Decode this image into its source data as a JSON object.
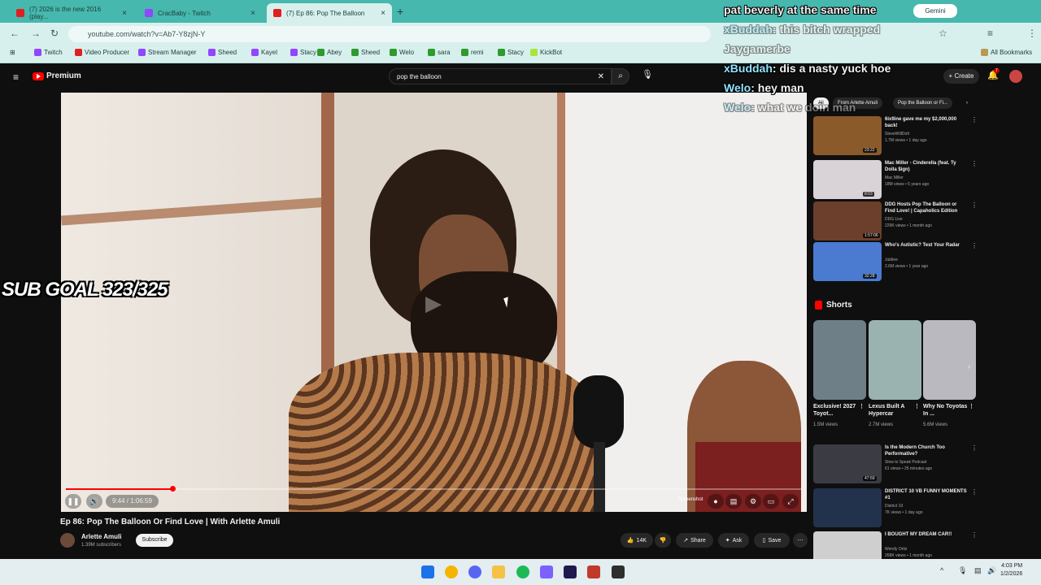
{
  "browser": {
    "tabs": [
      {
        "label": "(7) 2026 is the new 2016 (play...",
        "color": "#e02020"
      },
      {
        "label": "CracBaby - Twitch",
        "color": "#9146ff"
      },
      {
        "label": "(7) Ep 86: Pop The Balloon",
        "color": "#e02020"
      }
    ],
    "url": "youtube.com/watch?v=Ab7-Y8zjN-Y",
    "gemini_label": "Gemini",
    "bookmarks": [
      "Twitch",
      "Video Producer",
      "Stream Manager",
      "Sheed",
      "Kayel",
      "Stacy",
      "Abey",
      "Sheed",
      "Welo",
      "sara",
      "remi",
      "Stacy",
      "KickBot"
    ],
    "all_bookmarks": "All Bookmarks"
  },
  "youtube": {
    "logo": "Premium",
    "search_value": "pop the balloon",
    "create_label": "Create",
    "notif_count": "7",
    "video": {
      "title": "Ep 86: Pop The Balloon Or Find Love | With Arlette Amuli",
      "time": "9:44 / 1:06:59",
      "progress": 0.145,
      "screenshot_label": "Screenshot"
    },
    "channel": {
      "name": "Arlette Amuli",
      "subs": "1.39M subscribers",
      "subscribe": "Subscribe"
    },
    "actions": {
      "likes": "14K",
      "share": "Share",
      "ask": "Ask",
      "save": "Save"
    },
    "chips": [
      "All",
      "From Arlette Amuli",
      "Pop the Balloon or Fi..."
    ],
    "recommendations": [
      {
        "title": "6ix9ine gave me my $2,000,000 back!",
        "channel": "SteveWillDoIt",
        "views": "1.7M views • 1 day ago",
        "duration": "23:22",
        "color": "#8a5a2b"
      },
      {
        "title": "Mac Miller - Cinderella (feat. Ty Dolla $ign)",
        "channel": "Mac Miller",
        "views": "18M views • 5 years ago",
        "duration": "8:03",
        "color": "#d9d2d6"
      },
      {
        "title": "DDG Hosts Pop The Balloon or Find Love! | Capaholics Edition",
        "channel": "DDG Live",
        "views": "229K views • 1 month ago",
        "duration": "1:57:06",
        "color": "#6b3f2c"
      },
      {
        "title": "Who's Autistic? Test Your Radar",
        "channel": "Jubilee",
        "views": "2.6M views • 1 year ago",
        "duration": "32:28",
        "color": "#4a7bd1"
      },
      {
        "title": "Is the Modern Church Too Performative?",
        "channel": "Slow to Speak Podcast",
        "views": "61 views • 25 minutes ago",
        "duration": "47:59",
        "color": "#3b3b44"
      },
      {
        "title": "DISTRICT 10 VB FUNNY MOMENTS #1",
        "channel": "District 10",
        "views": "7K views • 1 day ago",
        "duration": "",
        "color": "#22324d"
      },
      {
        "title": "I BOUGHT MY DREAM CAR!!",
        "channel": "Wendy Ortiz",
        "views": "268K views • 1 month ago",
        "duration": "",
        "color": "#cfcfcf"
      }
    ],
    "shorts_header": "Shorts",
    "shorts": [
      {
        "title": "Exclusive! 2027 Toyot...",
        "views": "1.5M views",
        "color": "#6f7f88"
      },
      {
        "title": "Lexus Built A Hypercar",
        "views": "2.7M views",
        "color": "#9bb3b0"
      },
      {
        "title": "Why No Toyotas In ...",
        "views": "5.6M views",
        "color": "#b9b9bf"
      }
    ]
  },
  "overlay": {
    "sub_goal": "SUB GOAL 323/325",
    "chat": [
      {
        "user": "",
        "text": "pat beverly at the same time",
        "faded": false
      },
      {
        "user": "xBuddah",
        "text": "this bitch wrapped",
        "faded": true
      },
      {
        "user": "",
        "text": "Jaygamerbe",
        "faded": true
      },
      {
        "user": "xBuddah",
        "text": "dis a nasty yuck hoe",
        "faded": false
      },
      {
        "user": "Welo",
        "text": "hey man",
        "faded": false
      },
      {
        "user": "Welo",
        "text": "what we doin man",
        "faded": true
      }
    ]
  },
  "taskbar": {
    "time": "4:03 PM",
    "date": "1/2/2026"
  }
}
